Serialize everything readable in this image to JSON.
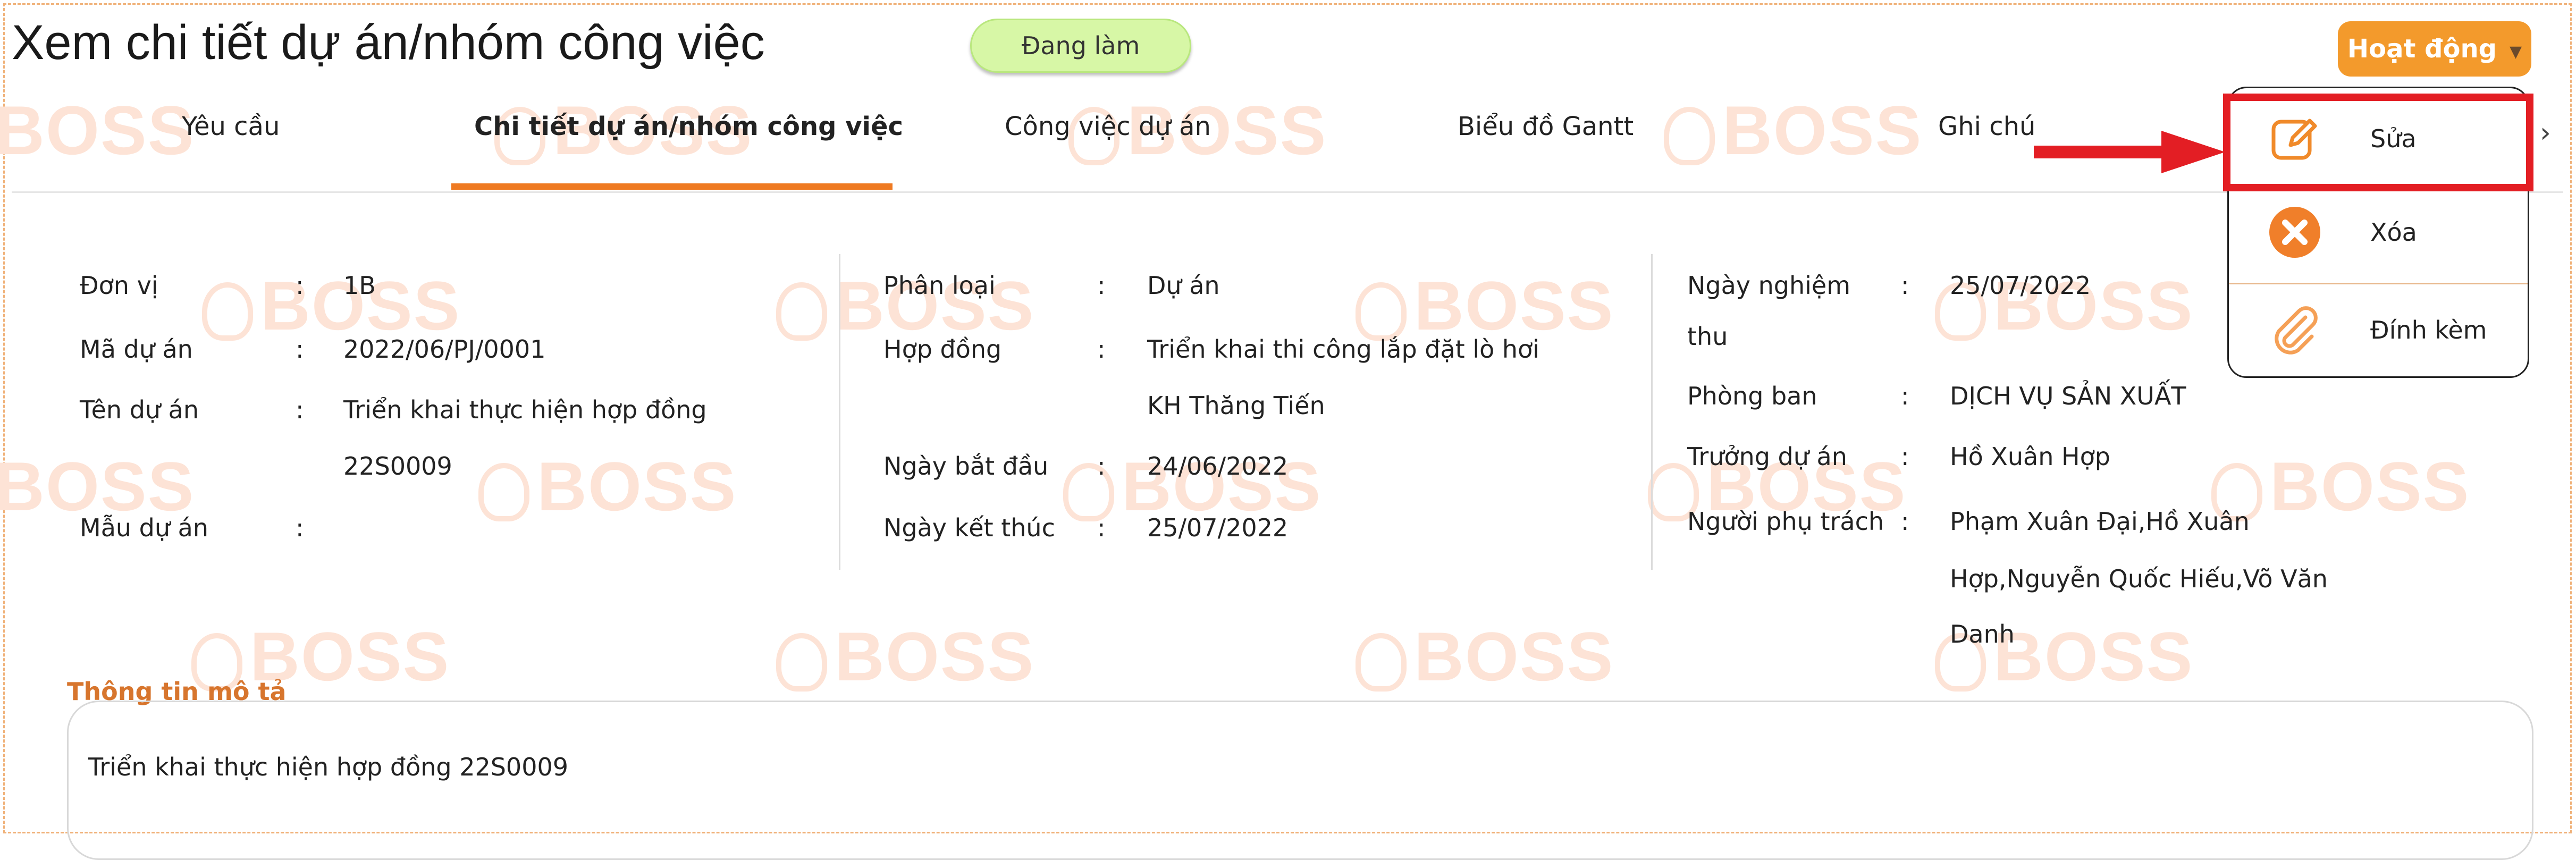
{
  "header": {
    "title": "Xem chi tiết dự án/nhóm công việc",
    "status": "Đang làm",
    "activity_label": "Hoạt động"
  },
  "watermark": "BOSS",
  "tabs": [
    {
      "label": "Yêu cầu",
      "active": false
    },
    {
      "label": "Chi tiết dự án/nhóm công việc",
      "active": true
    },
    {
      "label": "Công việc dự án",
      "active": false
    },
    {
      "label": "Biểu đồ Gantt",
      "active": false
    },
    {
      "label": "Ghi chú",
      "active": false
    }
  ],
  "menu": {
    "items": [
      {
        "label": "Sửa",
        "icon": "edit-icon"
      },
      {
        "label": "Xóa",
        "icon": "delete-icon"
      },
      {
        "label": "Đính kèm",
        "icon": "paperclip-icon"
      }
    ]
  },
  "details": {
    "col1": [
      {
        "label": "Đơn vị",
        "sep": ":",
        "value": "1B"
      },
      {
        "label": "Mã dự án",
        "sep": ":",
        "value": "2022/06/PJ/0001"
      },
      {
        "label": "Tên dự án",
        "sep": ":",
        "value": "Triển khai thực hiện hợp đồng",
        "value2": "22S0009"
      },
      {
        "label": "Mẫu dự án",
        "sep": ":",
        "value": ""
      }
    ],
    "col2": [
      {
        "label": "Phân loại",
        "sep": ":",
        "value": "Dự án"
      },
      {
        "label": "Hợp đồng",
        "sep": ":",
        "value": "Triển khai thi công lắp đặt lò hơi",
        "value2": "KH Thăng Tiến"
      },
      {
        "label": "Ngày bắt đầu",
        "sep": ":",
        "value": "24/06/2022"
      },
      {
        "label": "Ngày kết thúc",
        "sep": ":",
        "value": "25/07/2022"
      }
    ],
    "col3": [
      {
        "label": "Ngày nghiệm",
        "label2": "thu",
        "sep": ":",
        "value": "25/07/2022"
      },
      {
        "label": "Phòng ban",
        "sep": ":",
        "value": "DỊCH VỤ SẢN XUẤT"
      },
      {
        "label": "Trưởng dự án",
        "sep": ":",
        "value": "Hồ Xuân Hợp"
      },
      {
        "label": "Người phụ trách",
        "sep": ":",
        "value": "Phạm Xuân Đại,Hồ Xuân",
        "value2": "Hợp,Nguyễn Quốc Hiếu,Võ Văn",
        "value3": "Danh"
      }
    ]
  },
  "description": {
    "title": "Thông tin mô tả",
    "text": "Triển khai thực hiện hợp đồng 22S0009"
  },
  "colors": {
    "accent": "#ef7a22",
    "highlight": "#e31e24",
    "status_bg": "#d7f7a6",
    "button_bg": "#f39a2c"
  }
}
